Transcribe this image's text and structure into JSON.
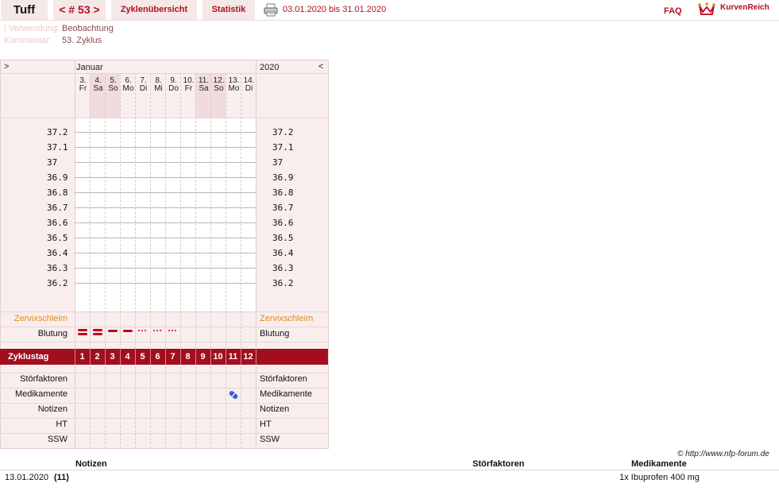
{
  "header": {
    "name": "Tuff",
    "cycle_nav": "< # 53 >",
    "overview": "Zyklenübersicht",
    "statistics": "Statistik",
    "date_range": "03.01.2020 bis 31.01.2020",
    "faq": "FAQ",
    "logo_text": "KurvenReich"
  },
  "meta": {
    "usage_label": "| Verwendung:",
    "usage_value": "Beobachtung",
    "comment_label": "Kommentar:",
    "comment_value": "53. Zyklus"
  },
  "chart": {
    "left_arrow": ">",
    "right_arrow": "<",
    "month": "Januar",
    "year": "2020",
    "days": [
      {
        "date": "3.",
        "wd": "Fr"
      },
      {
        "date": "4.",
        "wd": "Sa"
      },
      {
        "date": "5.",
        "wd": "So"
      },
      {
        "date": "6.",
        "wd": "Mo"
      },
      {
        "date": "7.",
        "wd": "Di"
      },
      {
        "date": "8.",
        "wd": "Mi"
      },
      {
        "date": "9.",
        "wd": "Do"
      },
      {
        "date": "10.",
        "wd": "Fr"
      },
      {
        "date": "11.",
        "wd": "Sa"
      },
      {
        "date": "12.",
        "wd": "So"
      },
      {
        "date": "13.",
        "wd": "Mo"
      },
      {
        "date": "14.",
        "wd": "Di"
      }
    ],
    "temps": [
      "37.2",
      "37.1",
      "37",
      "36.9",
      "36.8",
      "36.7",
      "36.6",
      "36.5",
      "36.4",
      "36.3",
      "36.2"
    ],
    "cervix_label": "Zervixschleim",
    "bleeding_label": "Blutung",
    "bleeding": [
      "heavy",
      "heavy",
      "medium",
      "medium",
      "light",
      "light",
      "light",
      "",
      "",
      "",
      "",
      ""
    ],
    "cycle_day_label": "Zyklustag",
    "cycle_days": [
      "1",
      "2",
      "3",
      "4",
      "5",
      "6",
      "7",
      "8",
      "9",
      "10",
      "11",
      "12"
    ],
    "disturb_label": "Störfaktoren",
    "meds_label": "Medikamente",
    "meds_day_index": 10,
    "notes_label": "Notizen",
    "ht_label": "HT",
    "ssw_label": "SSW"
  },
  "footer": {
    "copyright": "© http://www.nfp-forum.de",
    "col_notes": "Notizen",
    "col_disturb": "Störfaktoren",
    "col_meds": "Medikamente",
    "entry_date": "13.01.2020",
    "entry_day": "(11)",
    "entry_meds": "1x Ibuprofen 400 mg"
  },
  "colors": {
    "accent": "#a30e1e",
    "text_red": "#b01020",
    "bleeding": "#c4001c",
    "pill": "#3a5fd0",
    "cervix_orange": "#e08a20"
  }
}
